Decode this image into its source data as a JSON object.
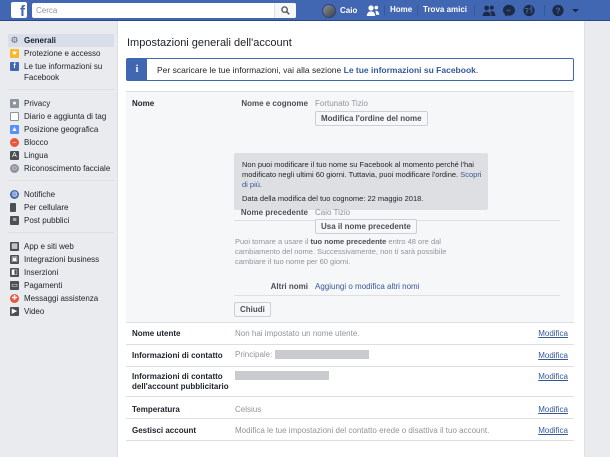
{
  "topbar": {
    "search_placeholder": "Cerca",
    "profile_name": "Caio",
    "home": "Home",
    "find_friends": "Trova amici"
  },
  "leftnav": {
    "groups": [
      [
        {
          "label": "Generali",
          "icon": "gear-icon",
          "active": true
        },
        {
          "label": "Protezione e accesso",
          "icon": "shield-icon"
        },
        {
          "label": "Le tue informazioni su Facebook",
          "icon": "facebook-icon"
        }
      ],
      [
        {
          "label": "Privacy",
          "icon": "lock-icon"
        },
        {
          "label": "Diario e aggiunta di tag",
          "icon": "timeline-icon"
        },
        {
          "label": "Posizione geografica",
          "icon": "location-icon"
        },
        {
          "label": "Blocco",
          "icon": "block-icon"
        },
        {
          "label": "Lingua",
          "icon": "language-icon"
        },
        {
          "label": "Riconoscimento facciale",
          "icon": "face-icon"
        }
      ],
      [
        {
          "label": "Notifiche",
          "icon": "globe-icon"
        },
        {
          "label": "Per cellulare",
          "icon": "mobile-icon"
        },
        {
          "label": "Post pubblici",
          "icon": "rss-icon"
        }
      ],
      [
        {
          "label": "App e siti web",
          "icon": "apps-icon"
        },
        {
          "label": "Integrazioni business",
          "icon": "business-icon"
        },
        {
          "label": "Inserzioni",
          "icon": "ads-icon"
        },
        {
          "label": "Pagamenti",
          "icon": "payments-icon"
        },
        {
          "label": "Messaggi assistenza",
          "icon": "support-icon"
        },
        {
          "label": "Video",
          "icon": "video-icon"
        }
      ]
    ]
  },
  "main": {
    "title": "Impostazioni generali dell'account",
    "info_prefix": "Per scaricare le tue informazioni, vai alla sezione ",
    "info_link": "Le tue informazioni su Facebook",
    "info_suffix": ".",
    "name_section": {
      "label": "Nome",
      "full_name_label": "Nome e cognome",
      "full_name_value": "Fortunato Tizio",
      "change_order_button": "Modifica l'ordine del nome",
      "warning_text": "Non puoi modificare il tuo nome su Facebook al momento perché l'hai modificato negli ultimi 60 giorni. Tuttavia, puoi modificare l'ordine.",
      "warning_link": "Scopri di più.",
      "warning_date": "Data della modifica del tuo cognome: 22 maggio 2018.",
      "previous_label": "Nome precedente",
      "previous_value": "Caio Tizio",
      "use_name_button": "Usa il nome precedente",
      "note_prefix": "Puoi tornare a usare il ",
      "note_bold": "tuo nome precedente",
      "note_suffix": " entro 48 ore dal cambiamento del nome. Successivamente, non ti sarà possibile cambiare il tuo nome per 60 giorni.",
      "other_names_label": "Altri nomi",
      "other_names_link": "Aggiungi o modifica altri nomi",
      "close_button": "Chiudi"
    },
    "rows": [
      {
        "label": "Nome utente",
        "value": "Non hai impostato un nome utente.",
        "edit": "Modifica"
      },
      {
        "label": "Informazioni di contatto",
        "value": "Principale:",
        "edit": "Modifica"
      },
      {
        "label": "Informazioni di contatto dell'account pubblicitario",
        "value": "",
        "edit": "Modifica"
      },
      {
        "label": "Temperatura",
        "value": "Celsius",
        "edit": "Modifica"
      },
      {
        "label": "Gestisci account",
        "value": "Modifica le tue impostazioni del contatto erede o disattiva il tuo account.",
        "edit": "Modifica"
      }
    ]
  },
  "colors": {
    "brand": "#4267b2",
    "link": "#365899",
    "panel_bg": "#f6f7f9",
    "page_bg": "#e9ebee"
  }
}
